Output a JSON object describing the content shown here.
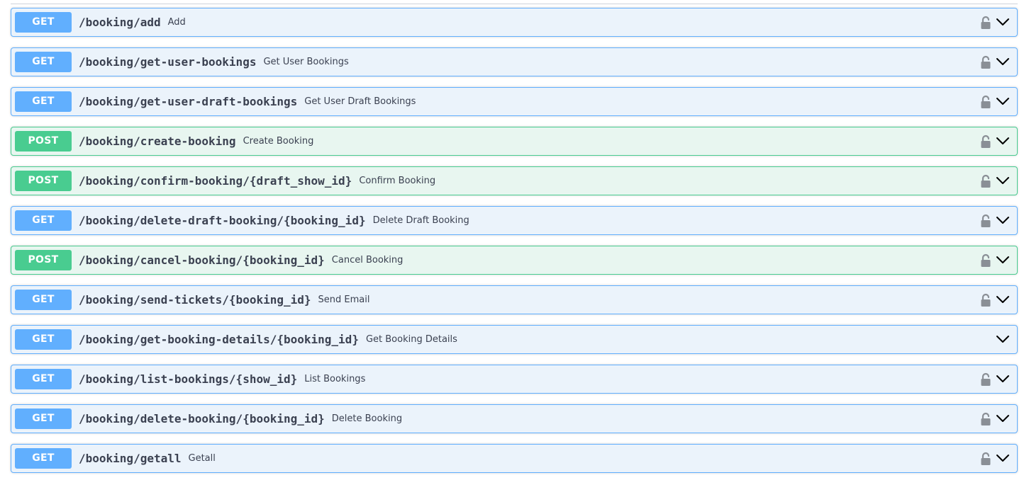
{
  "endpoints": [
    {
      "method": "GET",
      "path": "/booking/add",
      "summary": "Add",
      "locked": true
    },
    {
      "method": "GET",
      "path": "/booking/get-user-bookings",
      "summary": "Get User Bookings",
      "locked": true
    },
    {
      "method": "GET",
      "path": "/booking/get-user-draft-bookings",
      "summary": "Get User Draft Bookings",
      "locked": true
    },
    {
      "method": "POST",
      "path": "/booking/create-booking",
      "summary": "Create Booking",
      "locked": true
    },
    {
      "method": "POST",
      "path": "/booking/confirm-booking/{draft_show_id}",
      "summary": "Confirm Booking",
      "locked": true
    },
    {
      "method": "GET",
      "path": "/booking/delete-draft-booking/{booking_id}",
      "summary": "Delete Draft Booking",
      "locked": true
    },
    {
      "method": "POST",
      "path": "/booking/cancel-booking/{booking_id}",
      "summary": "Cancel Booking",
      "locked": true
    },
    {
      "method": "GET",
      "path": "/booking/send-tickets/{booking_id}",
      "summary": "Send Email",
      "locked": true
    },
    {
      "method": "GET",
      "path": "/booking/get-booking-details/{booking_id}",
      "summary": "Get Booking Details",
      "locked": false
    },
    {
      "method": "GET",
      "path": "/booking/list-bookings/{show_id}",
      "summary": "List Bookings",
      "locked": true
    },
    {
      "method": "GET",
      "path": "/booking/delete-booking/{booking_id}",
      "summary": "Delete Booking",
      "locked": true
    },
    {
      "method": "GET",
      "path": "/booking/getall",
      "summary": "Getall",
      "locked": true
    }
  ],
  "icons": {
    "lock": "unlocked-padlock-icon",
    "expand": "chevron-down-icon"
  },
  "colors": {
    "get_accent": "#61affe",
    "get_bg": "#ebf3fb",
    "post_accent": "#49cc90",
    "post_bg": "#e8f6f0",
    "text": "#3b4151"
  }
}
